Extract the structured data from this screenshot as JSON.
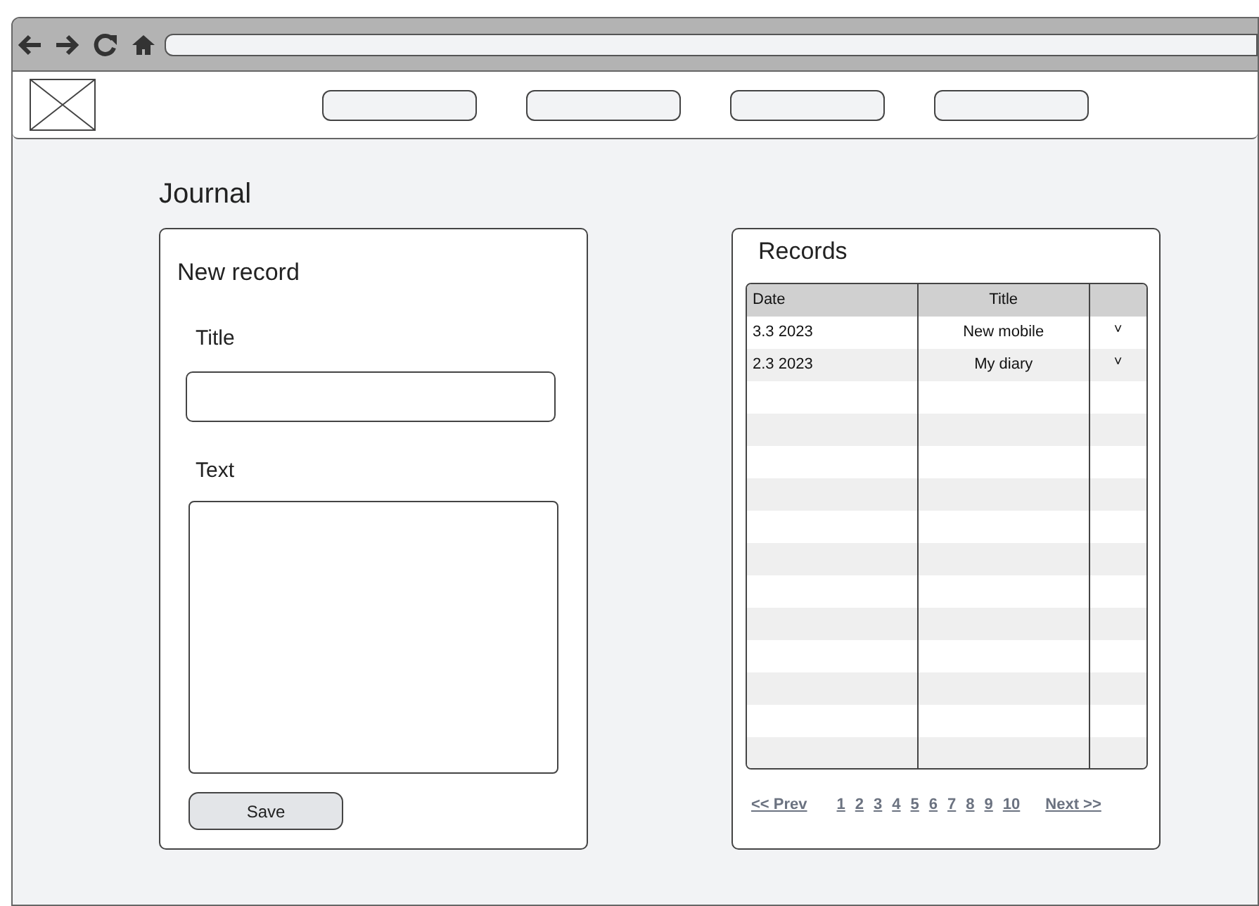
{
  "page": {
    "title": "Journal"
  },
  "new_record": {
    "heading": "New record",
    "title_label": "Title",
    "text_label": "Text",
    "save": "Save"
  },
  "records": {
    "heading": "Records",
    "columns": [
      "Date",
      "Title"
    ],
    "rows": [
      {
        "date": "3.3 2023",
        "title": "New mobile",
        "toggle": "˅"
      },
      {
        "date": "2.3 2023",
        "title": "My diary",
        "toggle": "˅"
      }
    ],
    "pagination": {
      "prev": "<< Prev",
      "pages": [
        "1",
        "2",
        "3",
        "4",
        "5",
        "6",
        "7",
        "8",
        "9",
        "10"
      ],
      "next": "Next >>"
    }
  }
}
